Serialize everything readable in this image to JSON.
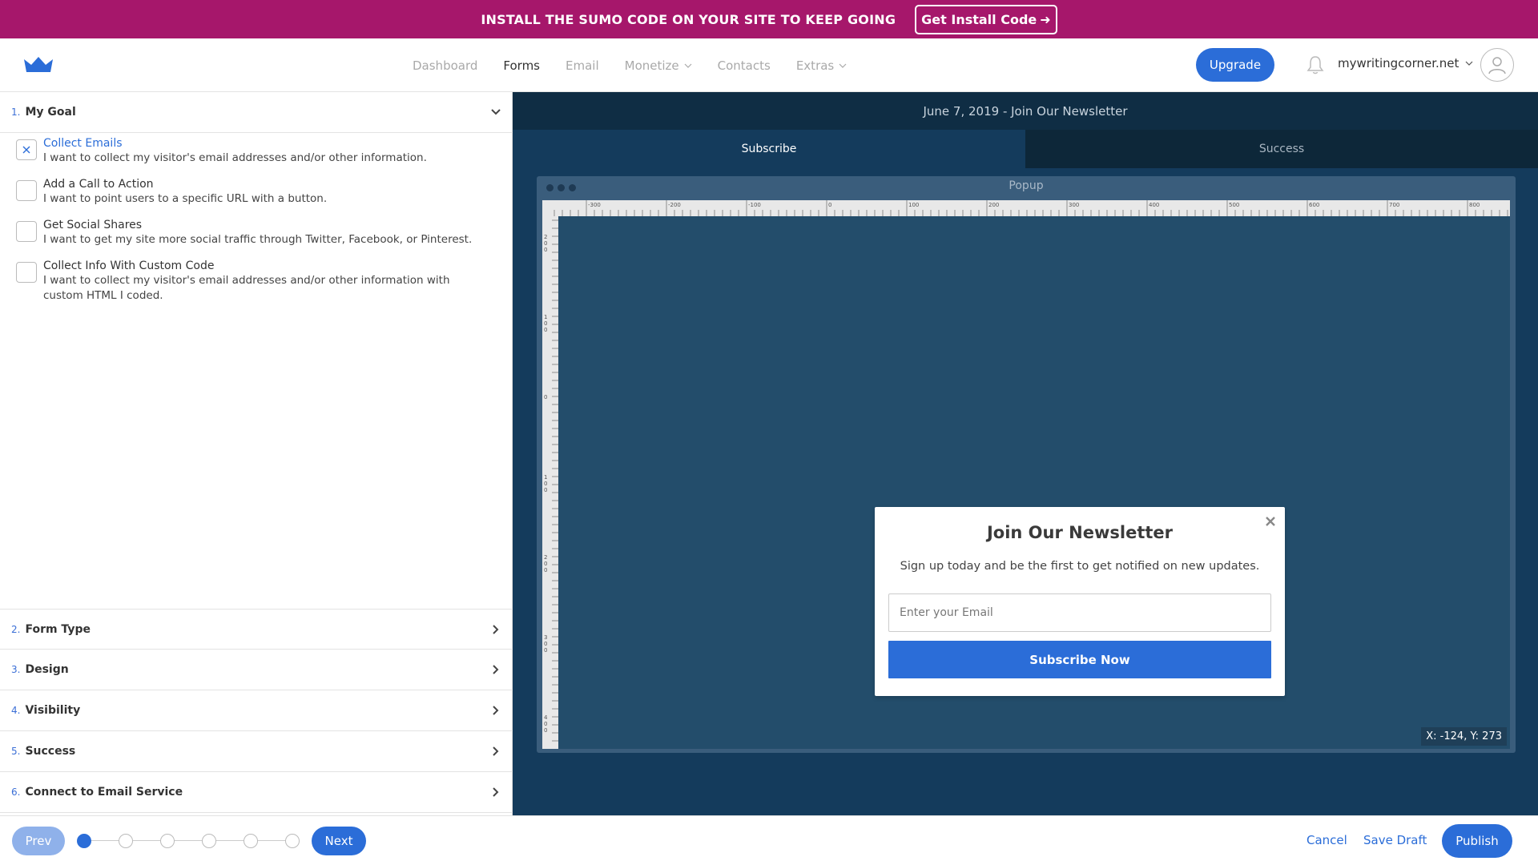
{
  "banner": {
    "text": "INSTALL THE SUMO CODE ON YOUR SITE TO KEEP GOING",
    "button_label": "Get Install Code",
    "background": "#a6176b"
  },
  "nav": {
    "links": [
      {
        "label": "Dashboard",
        "active": false
      },
      {
        "label": "Forms",
        "active": true
      },
      {
        "label": "Email",
        "active": false
      },
      {
        "label": "Monetize",
        "active": false,
        "dropdown": true
      },
      {
        "label": "Contacts",
        "active": false
      },
      {
        "label": "Extras",
        "active": false,
        "dropdown": true
      }
    ],
    "upgrade_label": "Upgrade",
    "account_name": "mywritingcorner.net"
  },
  "steps": [
    {
      "num": "1.",
      "label": "My Goal",
      "expanded": true
    },
    {
      "num": "2.",
      "label": "Form Type"
    },
    {
      "num": "3.",
      "label": "Design"
    },
    {
      "num": "4.",
      "label": "Visibility"
    },
    {
      "num": "5.",
      "label": "Success"
    },
    {
      "num": "6.",
      "label": "Connect to Email Service"
    }
  ],
  "goals": [
    {
      "title": "Collect Emails",
      "desc": "I want to collect my visitor's email addresses and/or other information.",
      "selected": true
    },
    {
      "title": "Add a Call to Action",
      "desc": "I want to point users to a specific URL with a button.",
      "selected": false
    },
    {
      "title": "Get Social Shares",
      "desc": "I want to get my site more social traffic through Twitter, Facebook, or Pinterest.",
      "selected": false
    },
    {
      "title": "Collect Info With Custom Code",
      "desc": "I want to collect my visitor's email addresses and/or other information with custom HTML I coded.",
      "selected": false
    }
  ],
  "footer": {
    "prev_label": "Prev",
    "next_label": "Next",
    "progress_total": 6,
    "progress_current": 1,
    "cancel_label": "Cancel",
    "save_draft_label": "Save Draft",
    "publish_label": "Publish"
  },
  "editor": {
    "form_title": "June 7, 2019 - Join Our Newsletter",
    "tabs": [
      {
        "label": "Subscribe",
        "active": true
      },
      {
        "label": "Success",
        "active": false
      }
    ],
    "frame_title": "Popup",
    "coords": "X: -124, Y: 273",
    "ruler_top_labels": [
      "-300",
      "-200",
      "-100",
      "0",
      "100",
      "200",
      "300",
      "400",
      "500",
      "600",
      "700",
      "800"
    ],
    "ruler_left_labels": [
      "200",
      "100",
      "0",
      "100",
      "200",
      "300",
      "400"
    ]
  },
  "popup": {
    "title": "Join Our Newsletter",
    "subtitle": "Sign up today and be the first to get notified on new updates.",
    "email_placeholder": "Enter your Email",
    "button_label": "Subscribe Now"
  }
}
